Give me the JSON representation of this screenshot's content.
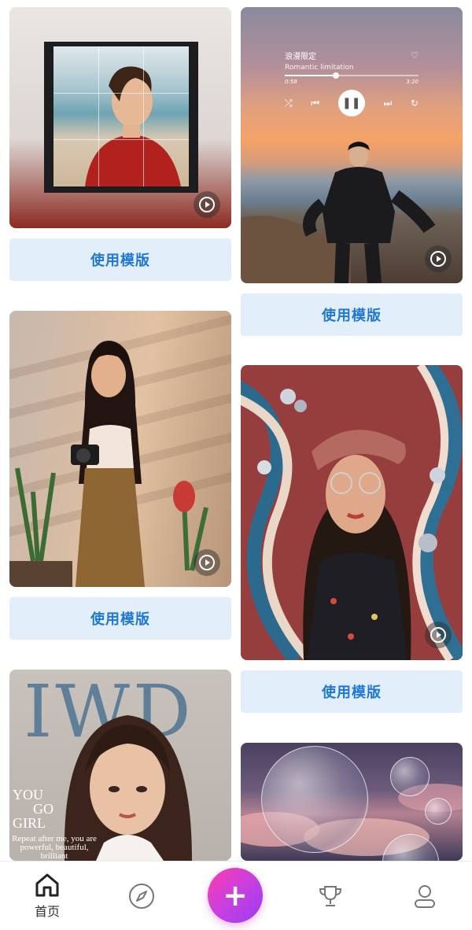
{
  "feed": {
    "use_template_label": "使用模版",
    "cards": [
      {
        "id": "card1"
      },
      {
        "id": "card2",
        "music": {
          "title": "浪漫限定",
          "subtitle": "Romantic limitation",
          "time_current": "0:58",
          "time_total": "3:20",
          "progress": 0.38
        }
      },
      {
        "id": "card3"
      },
      {
        "id": "card4"
      },
      {
        "id": "card5",
        "magazine": {
          "masthead": "IWD",
          "headline_lines": [
            "YOU",
            "GO",
            "GIRL"
          ],
          "quote": "Repeat after me, you are powerful, beautiful, brilliant"
        }
      },
      {
        "id": "card6"
      }
    ]
  },
  "nav": {
    "home_label": "首页",
    "items": [
      "home-icon",
      "compass-icon",
      "plus-icon",
      "trophy-icon",
      "user-icon"
    ],
    "accent_gradient": [
      "#ff3cac",
      "#9a3df2"
    ]
  },
  "colors": {
    "button_bg": "#e3eefb",
    "button_text": "#1f77d6"
  }
}
